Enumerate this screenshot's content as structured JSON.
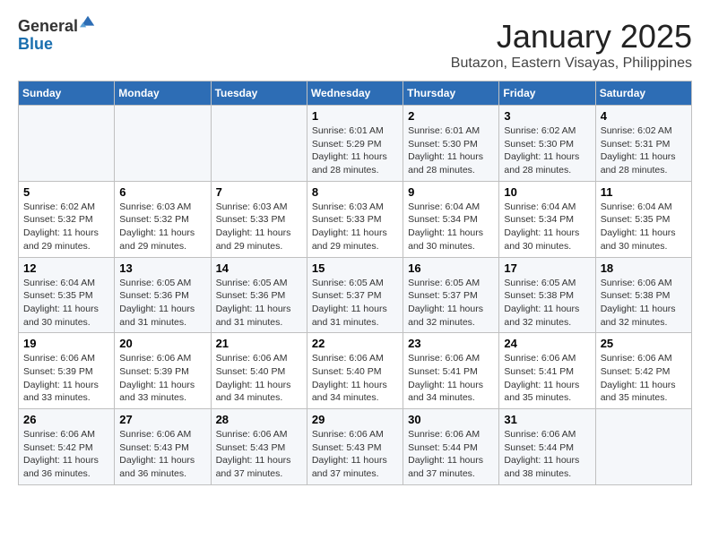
{
  "header": {
    "logo_general": "General",
    "logo_blue": "Blue",
    "month_title": "January 2025",
    "location": "Butazon, Eastern Visayas, Philippines"
  },
  "weekdays": [
    "Sunday",
    "Monday",
    "Tuesday",
    "Wednesday",
    "Thursday",
    "Friday",
    "Saturday"
  ],
  "rows": [
    [
      {
        "day": "",
        "info": ""
      },
      {
        "day": "",
        "info": ""
      },
      {
        "day": "",
        "info": ""
      },
      {
        "day": "1",
        "info": "Sunrise: 6:01 AM\nSunset: 5:29 PM\nDaylight: 11 hours and 28 minutes."
      },
      {
        "day": "2",
        "info": "Sunrise: 6:01 AM\nSunset: 5:30 PM\nDaylight: 11 hours and 28 minutes."
      },
      {
        "day": "3",
        "info": "Sunrise: 6:02 AM\nSunset: 5:30 PM\nDaylight: 11 hours and 28 minutes."
      },
      {
        "day": "4",
        "info": "Sunrise: 6:02 AM\nSunset: 5:31 PM\nDaylight: 11 hours and 28 minutes."
      }
    ],
    [
      {
        "day": "5",
        "info": "Sunrise: 6:02 AM\nSunset: 5:32 PM\nDaylight: 11 hours and 29 minutes."
      },
      {
        "day": "6",
        "info": "Sunrise: 6:03 AM\nSunset: 5:32 PM\nDaylight: 11 hours and 29 minutes."
      },
      {
        "day": "7",
        "info": "Sunrise: 6:03 AM\nSunset: 5:33 PM\nDaylight: 11 hours and 29 minutes."
      },
      {
        "day": "8",
        "info": "Sunrise: 6:03 AM\nSunset: 5:33 PM\nDaylight: 11 hours and 29 minutes."
      },
      {
        "day": "9",
        "info": "Sunrise: 6:04 AM\nSunset: 5:34 PM\nDaylight: 11 hours and 30 minutes."
      },
      {
        "day": "10",
        "info": "Sunrise: 6:04 AM\nSunset: 5:34 PM\nDaylight: 11 hours and 30 minutes."
      },
      {
        "day": "11",
        "info": "Sunrise: 6:04 AM\nSunset: 5:35 PM\nDaylight: 11 hours and 30 minutes."
      }
    ],
    [
      {
        "day": "12",
        "info": "Sunrise: 6:04 AM\nSunset: 5:35 PM\nDaylight: 11 hours and 30 minutes."
      },
      {
        "day": "13",
        "info": "Sunrise: 6:05 AM\nSunset: 5:36 PM\nDaylight: 11 hours and 31 minutes."
      },
      {
        "day": "14",
        "info": "Sunrise: 6:05 AM\nSunset: 5:36 PM\nDaylight: 11 hours and 31 minutes."
      },
      {
        "day": "15",
        "info": "Sunrise: 6:05 AM\nSunset: 5:37 PM\nDaylight: 11 hours and 31 minutes."
      },
      {
        "day": "16",
        "info": "Sunrise: 6:05 AM\nSunset: 5:37 PM\nDaylight: 11 hours and 32 minutes."
      },
      {
        "day": "17",
        "info": "Sunrise: 6:05 AM\nSunset: 5:38 PM\nDaylight: 11 hours and 32 minutes."
      },
      {
        "day": "18",
        "info": "Sunrise: 6:06 AM\nSunset: 5:38 PM\nDaylight: 11 hours and 32 minutes."
      }
    ],
    [
      {
        "day": "19",
        "info": "Sunrise: 6:06 AM\nSunset: 5:39 PM\nDaylight: 11 hours and 33 minutes."
      },
      {
        "day": "20",
        "info": "Sunrise: 6:06 AM\nSunset: 5:39 PM\nDaylight: 11 hours and 33 minutes."
      },
      {
        "day": "21",
        "info": "Sunrise: 6:06 AM\nSunset: 5:40 PM\nDaylight: 11 hours and 34 minutes."
      },
      {
        "day": "22",
        "info": "Sunrise: 6:06 AM\nSunset: 5:40 PM\nDaylight: 11 hours and 34 minutes."
      },
      {
        "day": "23",
        "info": "Sunrise: 6:06 AM\nSunset: 5:41 PM\nDaylight: 11 hours and 34 minutes."
      },
      {
        "day": "24",
        "info": "Sunrise: 6:06 AM\nSunset: 5:41 PM\nDaylight: 11 hours and 35 minutes."
      },
      {
        "day": "25",
        "info": "Sunrise: 6:06 AM\nSunset: 5:42 PM\nDaylight: 11 hours and 35 minutes."
      }
    ],
    [
      {
        "day": "26",
        "info": "Sunrise: 6:06 AM\nSunset: 5:42 PM\nDaylight: 11 hours and 36 minutes."
      },
      {
        "day": "27",
        "info": "Sunrise: 6:06 AM\nSunset: 5:43 PM\nDaylight: 11 hours and 36 minutes."
      },
      {
        "day": "28",
        "info": "Sunrise: 6:06 AM\nSunset: 5:43 PM\nDaylight: 11 hours and 37 minutes."
      },
      {
        "day": "29",
        "info": "Sunrise: 6:06 AM\nSunset: 5:43 PM\nDaylight: 11 hours and 37 minutes."
      },
      {
        "day": "30",
        "info": "Sunrise: 6:06 AM\nSunset: 5:44 PM\nDaylight: 11 hours and 37 minutes."
      },
      {
        "day": "31",
        "info": "Sunrise: 6:06 AM\nSunset: 5:44 PM\nDaylight: 11 hours and 38 minutes."
      },
      {
        "day": "",
        "info": ""
      }
    ]
  ]
}
